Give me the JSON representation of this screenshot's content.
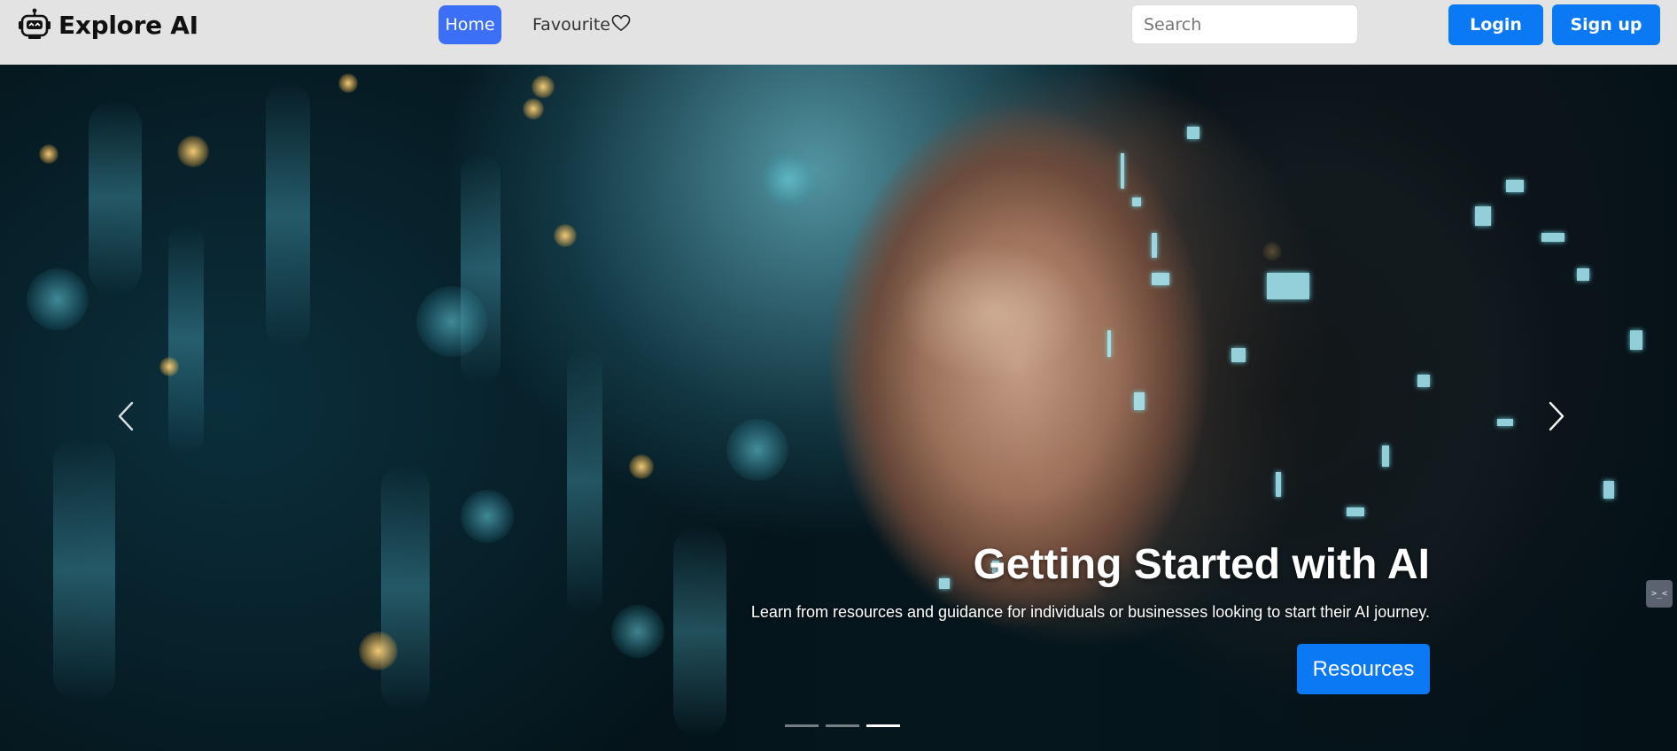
{
  "navbar": {
    "brand": "Explore AI",
    "brand_icon": "robot-icon",
    "home_label": "Home",
    "favourite_label": "Favourite",
    "favourite_icon": "heart-icon",
    "search_placeholder": "Search",
    "login_label": "Login",
    "signup_label": "Sign up"
  },
  "hero": {
    "title": "Getting Started with AI",
    "text": "Learn from resources and guidance for individuals or businesses looking to start their AI journey.",
    "button_label": "Resources",
    "slides_total": 3,
    "active_slide": 3,
    "prev_icon": "chevron-left-icon",
    "next_icon": "chevron-right-icon"
  },
  "side_tab": {
    "label": ">_<"
  },
  "colors": {
    "primary": "#0b79f4",
    "home_active": "#3b6ff5",
    "navbar_bg": "#e3e3e3"
  }
}
